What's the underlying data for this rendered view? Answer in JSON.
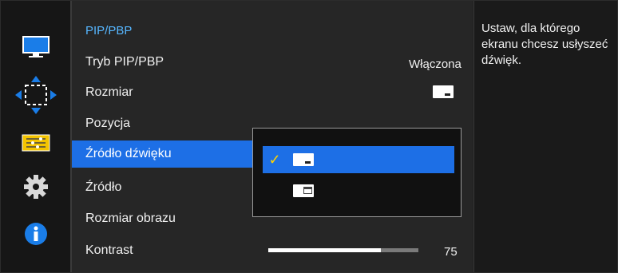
{
  "menu": {
    "title": "PIP/PBP",
    "items": [
      {
        "label": "Tryb PIP/PBP",
        "value": "Włączona"
      },
      {
        "label": "Rozmiar",
        "value_icon": "pip-small-window-icon"
      },
      {
        "label": "Pozycja"
      },
      {
        "label": "Źródło dźwięku",
        "selected": true
      },
      {
        "label": "Źródło"
      },
      {
        "label": "Rozmiar obrazu"
      },
      {
        "label": "Kontrast",
        "value": "75",
        "progress": 0.75
      }
    ]
  },
  "dropdown": {
    "options": [
      {
        "icon": "main-screen-sound-icon",
        "selected": true
      },
      {
        "icon": "sub-screen-sound-icon",
        "selected": false
      }
    ]
  },
  "help": {
    "text": "Ustaw, dla którego ekranu chcesz usłyszeć dźwięk."
  },
  "rail": {
    "icons": [
      "monitor-icon",
      "pip-arrows-icon",
      "settings-list-icon",
      "gear-icon",
      "info-icon"
    ]
  },
  "colors": {
    "accent": "#1d6fe6",
    "title": "#56b6ff",
    "check": "#ffd400"
  }
}
